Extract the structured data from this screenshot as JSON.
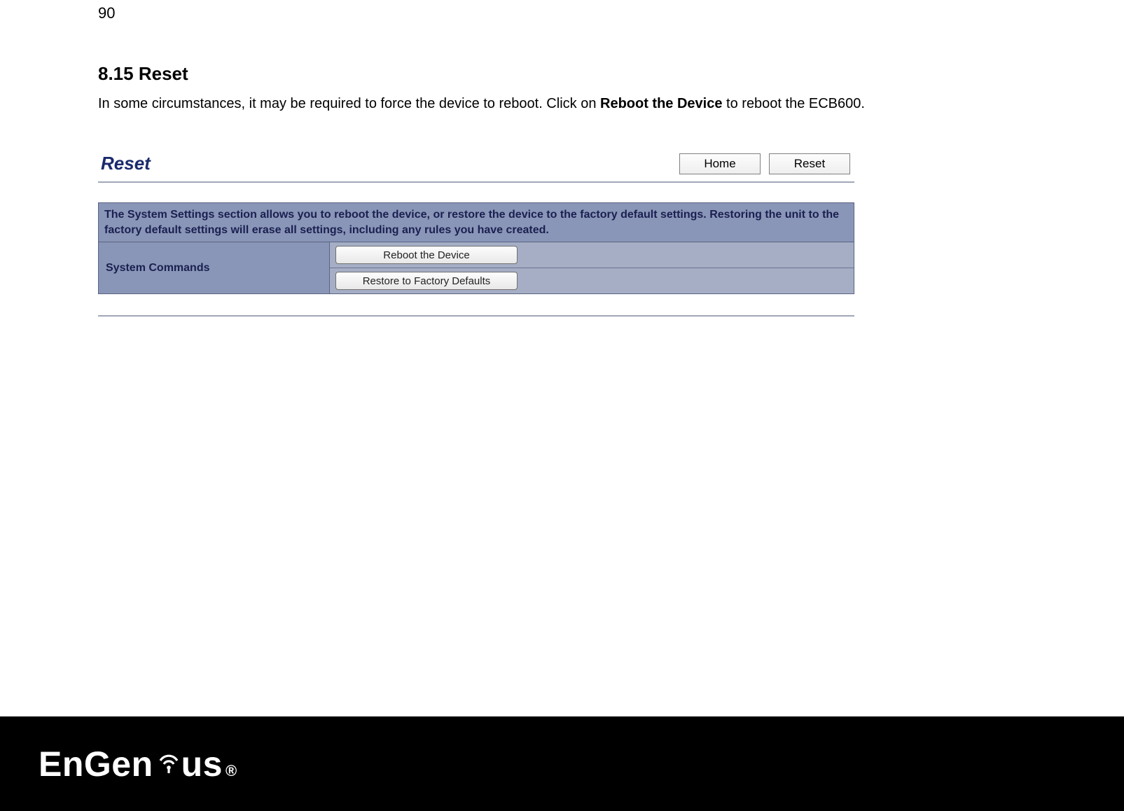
{
  "page_number": "90",
  "section": {
    "heading": "8.15 Reset",
    "body_prefix": "In some circumstances, it may be required to force the device to reboot. Click on ",
    "body_bold": "Reboot the Device",
    "body_suffix": " to reboot the ECB600."
  },
  "panel": {
    "title": "Reset",
    "nav": {
      "home": "Home",
      "reset": "Reset"
    },
    "info_banner": "The System Settings section allows you to reboot the device, or restore the device to the factory default settings. Restoring the unit to the factory default settings will erase all settings, including any rules you have created.",
    "commands_label": "System Commands",
    "buttons": {
      "reboot": "Reboot the Device",
      "restore": "Restore to Factory Defaults"
    }
  },
  "footer": {
    "brand_part1": "EnGen",
    "brand_part2": "us",
    "registered": "®"
  }
}
